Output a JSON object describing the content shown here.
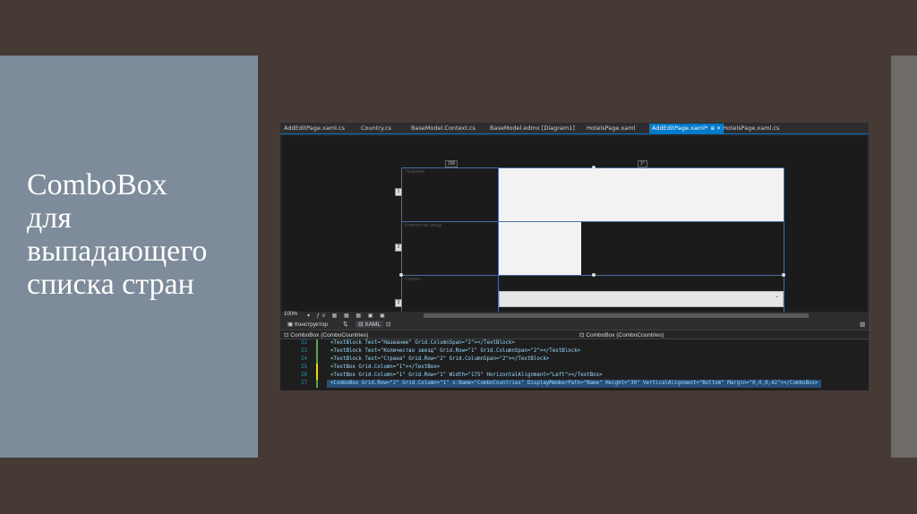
{
  "slide": {
    "title_lines": [
      "ComboBox",
      "для",
      "выпадающего",
      "списка стран"
    ]
  },
  "ide": {
    "tabs": [
      {
        "label": "AddEditPage.xaml.cs",
        "active": false
      },
      {
        "label": "Country.cs",
        "active": false
      },
      {
        "label": "BaseModel.Context.cs",
        "active": false
      },
      {
        "label": "BaseModel.edmx [Diagram1]",
        "active": false
      },
      {
        "label": "HotelsPage.xaml",
        "active": false
      },
      {
        "label": "AddEditPage.xaml*",
        "active": true
      },
      {
        "label": "HotelsPage.xaml.cs",
        "active": false
      }
    ],
    "designer": {
      "col_width_label": "200",
      "col_width_label2": "1*",
      "row_labels": [
        "Название",
        "Количество звезд",
        "Страна"
      ]
    },
    "zoom": "100%",
    "view_tabs": {
      "design": "Конструктор",
      "xaml": "XAML"
    },
    "breadcrumbs": {
      "left": "ComboBox (ComboCountries)",
      "right": "ComboBox (ComboCountries)"
    },
    "code_lines": [
      {
        "num": "22",
        "text": "<TextBlock Text=\"Название\" Grid.ColumnSpan=\"2\"></TextBlock>"
      },
      {
        "num": "23",
        "text": "<TextBlock Text=\"Количество звезд\" Grid.Row=\"1\" Grid.ColumnSpan=\"2\"></TextBlock>"
      },
      {
        "num": "24",
        "text": "<TextBlock Text=\"Страна\" Grid.Row=\"2\" Grid.ColumnSpan=\"2\"></TextBlock>"
      },
      {
        "num": "25",
        "text": "<TextBox Grid.Column=\"1\"></TextBox>"
      },
      {
        "num": "26",
        "text": "<TextBox Grid.Column=\"1\" Grid.Row=\"1\" Width=\"175\" HorizontalAlignment=\"Left\"></TextBox>"
      },
      {
        "num": "27",
        "text": "<ComboBox Grid.Row=\"2\" Grid.Column=\"1\" x:Name=\"ComboCountries\" DisplayMemberPath=\"Name\" Height=\"30\" VerticalAlignment=\"Bottom\" Margin=\"0,0,0,42\"></ComboBox>"
      }
    ]
  },
  "colors": {
    "background": "#463a35",
    "left_panel": "#7d8b9a",
    "accent": "#007acc"
  }
}
